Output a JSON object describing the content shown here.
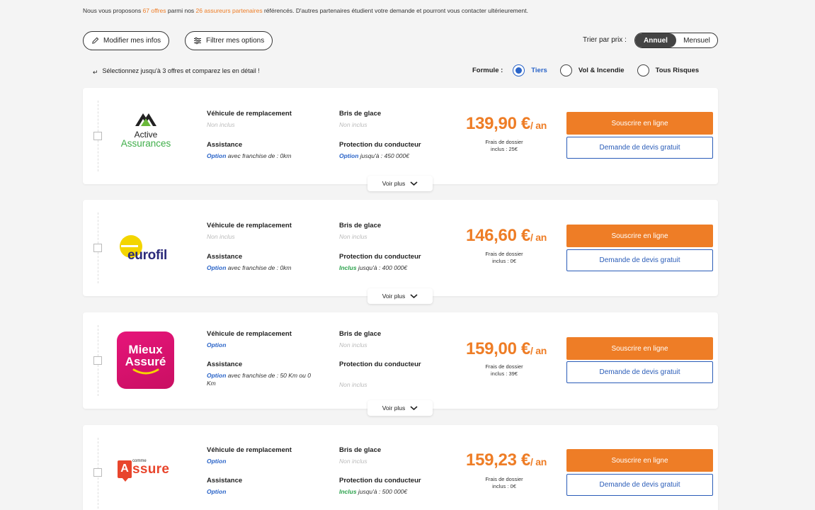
{
  "intro": {
    "prefix": "Nous vous proposons ",
    "offers": "67 offres",
    "middle": " parmi nos ",
    "partners": "26 assureurs partenaires",
    "suffix": " référencés. D'autres partenaires étudient votre demande et pourront vous contacter ultérieurement."
  },
  "toolbar": {
    "modify_label": "Modifier mes infos",
    "filter_label": "Filtrer mes options",
    "sort_label": "Trier par prix :",
    "sort_annual": "Annuel",
    "sort_monthly": "Mensuel"
  },
  "hint": "Sélectionnez jusqu'à 3 offres et comparez les en détail !",
  "formule": {
    "label": "Formule :",
    "options": [
      "Tiers",
      "Vol & Incendie",
      "Tous Risques"
    ],
    "selected": "Tiers"
  },
  "labels": {
    "vehicule": "Véhicule de remplacement",
    "bris": "Bris de glace",
    "assistance": "Assistance",
    "protection": "Protection du conducteur",
    "subscribe": "Souscrire en ligne",
    "devis": "Demande de devis gratuit",
    "voir_plus": "Voir plus",
    "unit": "/ an",
    "fees_line1": "Frais de dossier"
  },
  "offers": [
    {
      "insurer": "Active Assurances",
      "logo_line1": "Active",
      "logo_line2": "Assurances",
      "vehicule": "Non inclus",
      "bris": "Non inclus",
      "assistance_status": "Option",
      "assistance_detail": " avec franchise de : 0km",
      "protection_status": "Option",
      "protection_detail": " jusqu'à : 450 000€",
      "price": "139,90 €",
      "fees": "inclus : 25€"
    },
    {
      "insurer": "eurofil",
      "logo_text": "eurofil",
      "vehicule": "Non inclus",
      "bris": "Non inclus",
      "assistance_status": "Option",
      "assistance_detail": " avec franchise de : 0km",
      "protection_status": "Inclus",
      "protection_detail": " jusqu'à : 400 000€",
      "price": "146,60 €",
      "fees": "inclus : 0€"
    },
    {
      "insurer": "Mieux Assuré",
      "logo_line1": "Mieux",
      "logo_line2": "Assuré",
      "vehicule": "Option",
      "bris": "Non inclus",
      "assistance_status": "Option",
      "assistance_detail": " avec franchise de : 50 Km ou 0 Km",
      "protection_value": "Non inclus",
      "price": "159,00 €",
      "fees": "inclus : 39€"
    },
    {
      "insurer": "Comme Assure",
      "logo_small": "comme",
      "logo_a": "A",
      "logo_rest": "ssure",
      "vehicule": "Option",
      "bris": "Non inclus",
      "assistance_status": "Option",
      "protection_status": "Inclus",
      "protection_detail": " jusqu'à : 500 000€",
      "price": "159,23 €",
      "fees": "inclus : 0€"
    }
  ],
  "colors": {
    "accent": "#ee7d26",
    "link_blue": "#2a64c8",
    "included_green": "#2aa14b",
    "muted": "#bbbbbb"
  }
}
